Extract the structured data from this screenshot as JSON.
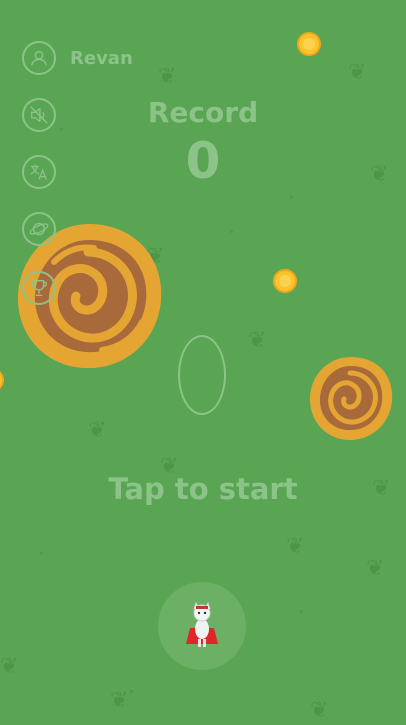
{
  "profile": {
    "username": "Revan",
    "avatar_icon": "user-icon"
  },
  "sidebar": {
    "buttons": [
      {
        "name": "sound-toggle",
        "icon": "speaker-muted-icon"
      },
      {
        "name": "language",
        "icon": "translate-icon"
      },
      {
        "name": "world",
        "icon": "planet-icon"
      },
      {
        "name": "leaderboard",
        "icon": "trophy-icon"
      }
    ]
  },
  "hud": {
    "record_label": "Record",
    "record_value": "0"
  },
  "prompt": {
    "tap_to_start": "Tap to start"
  },
  "colors": {
    "background": "#5aa554",
    "ui_accent": "#8cc388",
    "coin": "#f9c42c",
    "vortex_light": "#e5a533",
    "vortex_dark": "#a86a3b",
    "player_cape": "#e02626"
  }
}
